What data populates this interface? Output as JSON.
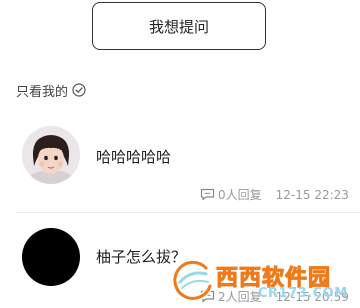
{
  "header": {
    "ask_button_label": "我想提问"
  },
  "filter": {
    "label": "只看我的",
    "icon": "check-circle-icon"
  },
  "questions": [
    {
      "avatar": "child-photo-avatar",
      "text": "哈哈哈哈哈",
      "replies": "0人回复",
      "time": "12-15 22:23"
    },
    {
      "avatar": "black-avatar",
      "text": "柚子怎么拔？",
      "replies": "2人回复",
      "time": "12-15 20:59"
    }
  ],
  "watermark": {
    "title": "西西软件园",
    "site": "CR173.COM"
  },
  "colors": {
    "meta_gray": "#999999",
    "divider": "#ededed",
    "watermark_orange": "#f07a1a",
    "watermark_blue": "#9ad6f0"
  }
}
